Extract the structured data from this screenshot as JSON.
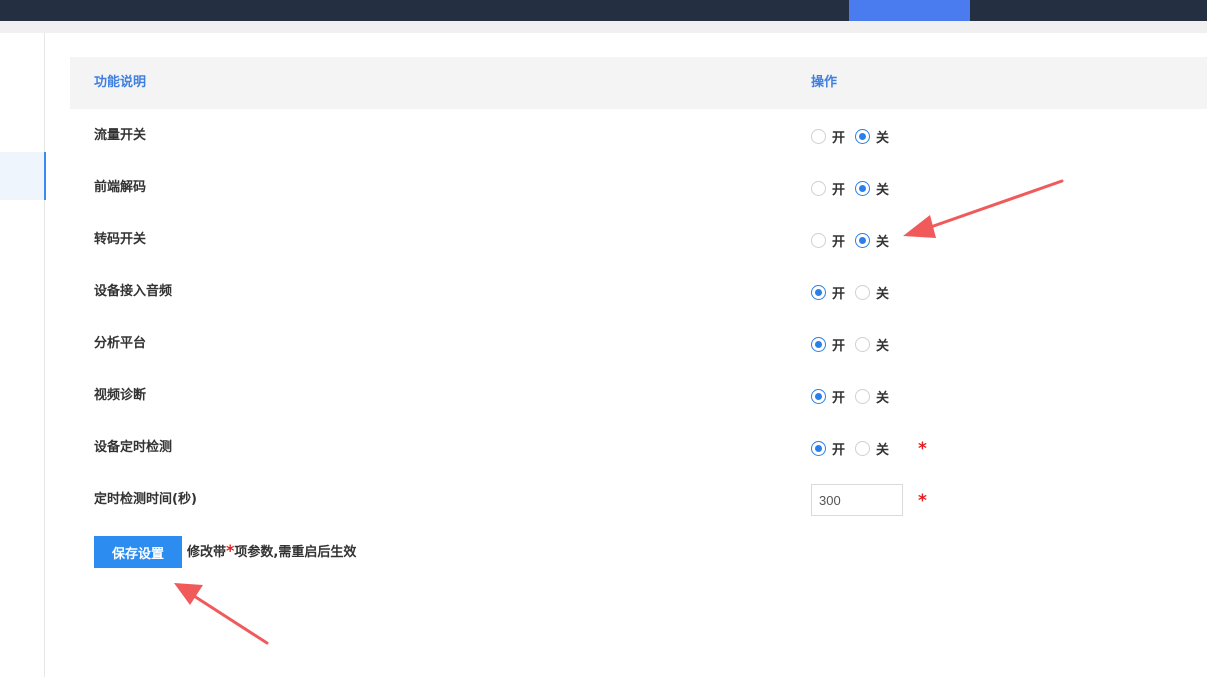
{
  "header": {
    "bar_color": "#252f42",
    "active_tab_color": "#4a7cf0"
  },
  "table": {
    "col_function": "功能说明",
    "col_operation": "操作",
    "rows": [
      {
        "label": "流量开关",
        "on_label": "开",
        "off_label": "关",
        "selected": "off",
        "required": false
      },
      {
        "label": "前端解码",
        "on_label": "开",
        "off_label": "关",
        "selected": "off",
        "required": false
      },
      {
        "label": "转码开关",
        "on_label": "开",
        "off_label": "关",
        "selected": "off",
        "required": false
      },
      {
        "label": "设备接入音频",
        "on_label": "开",
        "off_label": "关",
        "selected": "on",
        "required": false
      },
      {
        "label": "分析平台",
        "on_label": "开",
        "off_label": "关",
        "selected": "on",
        "required": false
      },
      {
        "label": "视频诊断",
        "on_label": "开",
        "off_label": "关",
        "selected": "on",
        "required": false
      },
      {
        "label": "设备定时检测",
        "on_label": "开",
        "off_label": "关",
        "selected": "on",
        "required": true
      }
    ],
    "timer_row": {
      "label": "定时检测时间(秒)",
      "value": "300",
      "required": true
    },
    "required_mark": "*"
  },
  "footer": {
    "save_label": "保存设置",
    "note_prefix": "修改带",
    "note_star": "*",
    "note_suffix": "项参数,需重启后生效"
  },
  "colors": {
    "accent": "#2c8cf0",
    "header_text": "#3f7fe0",
    "required": "#e02020",
    "annotation_arrow": "#f05a5a"
  }
}
